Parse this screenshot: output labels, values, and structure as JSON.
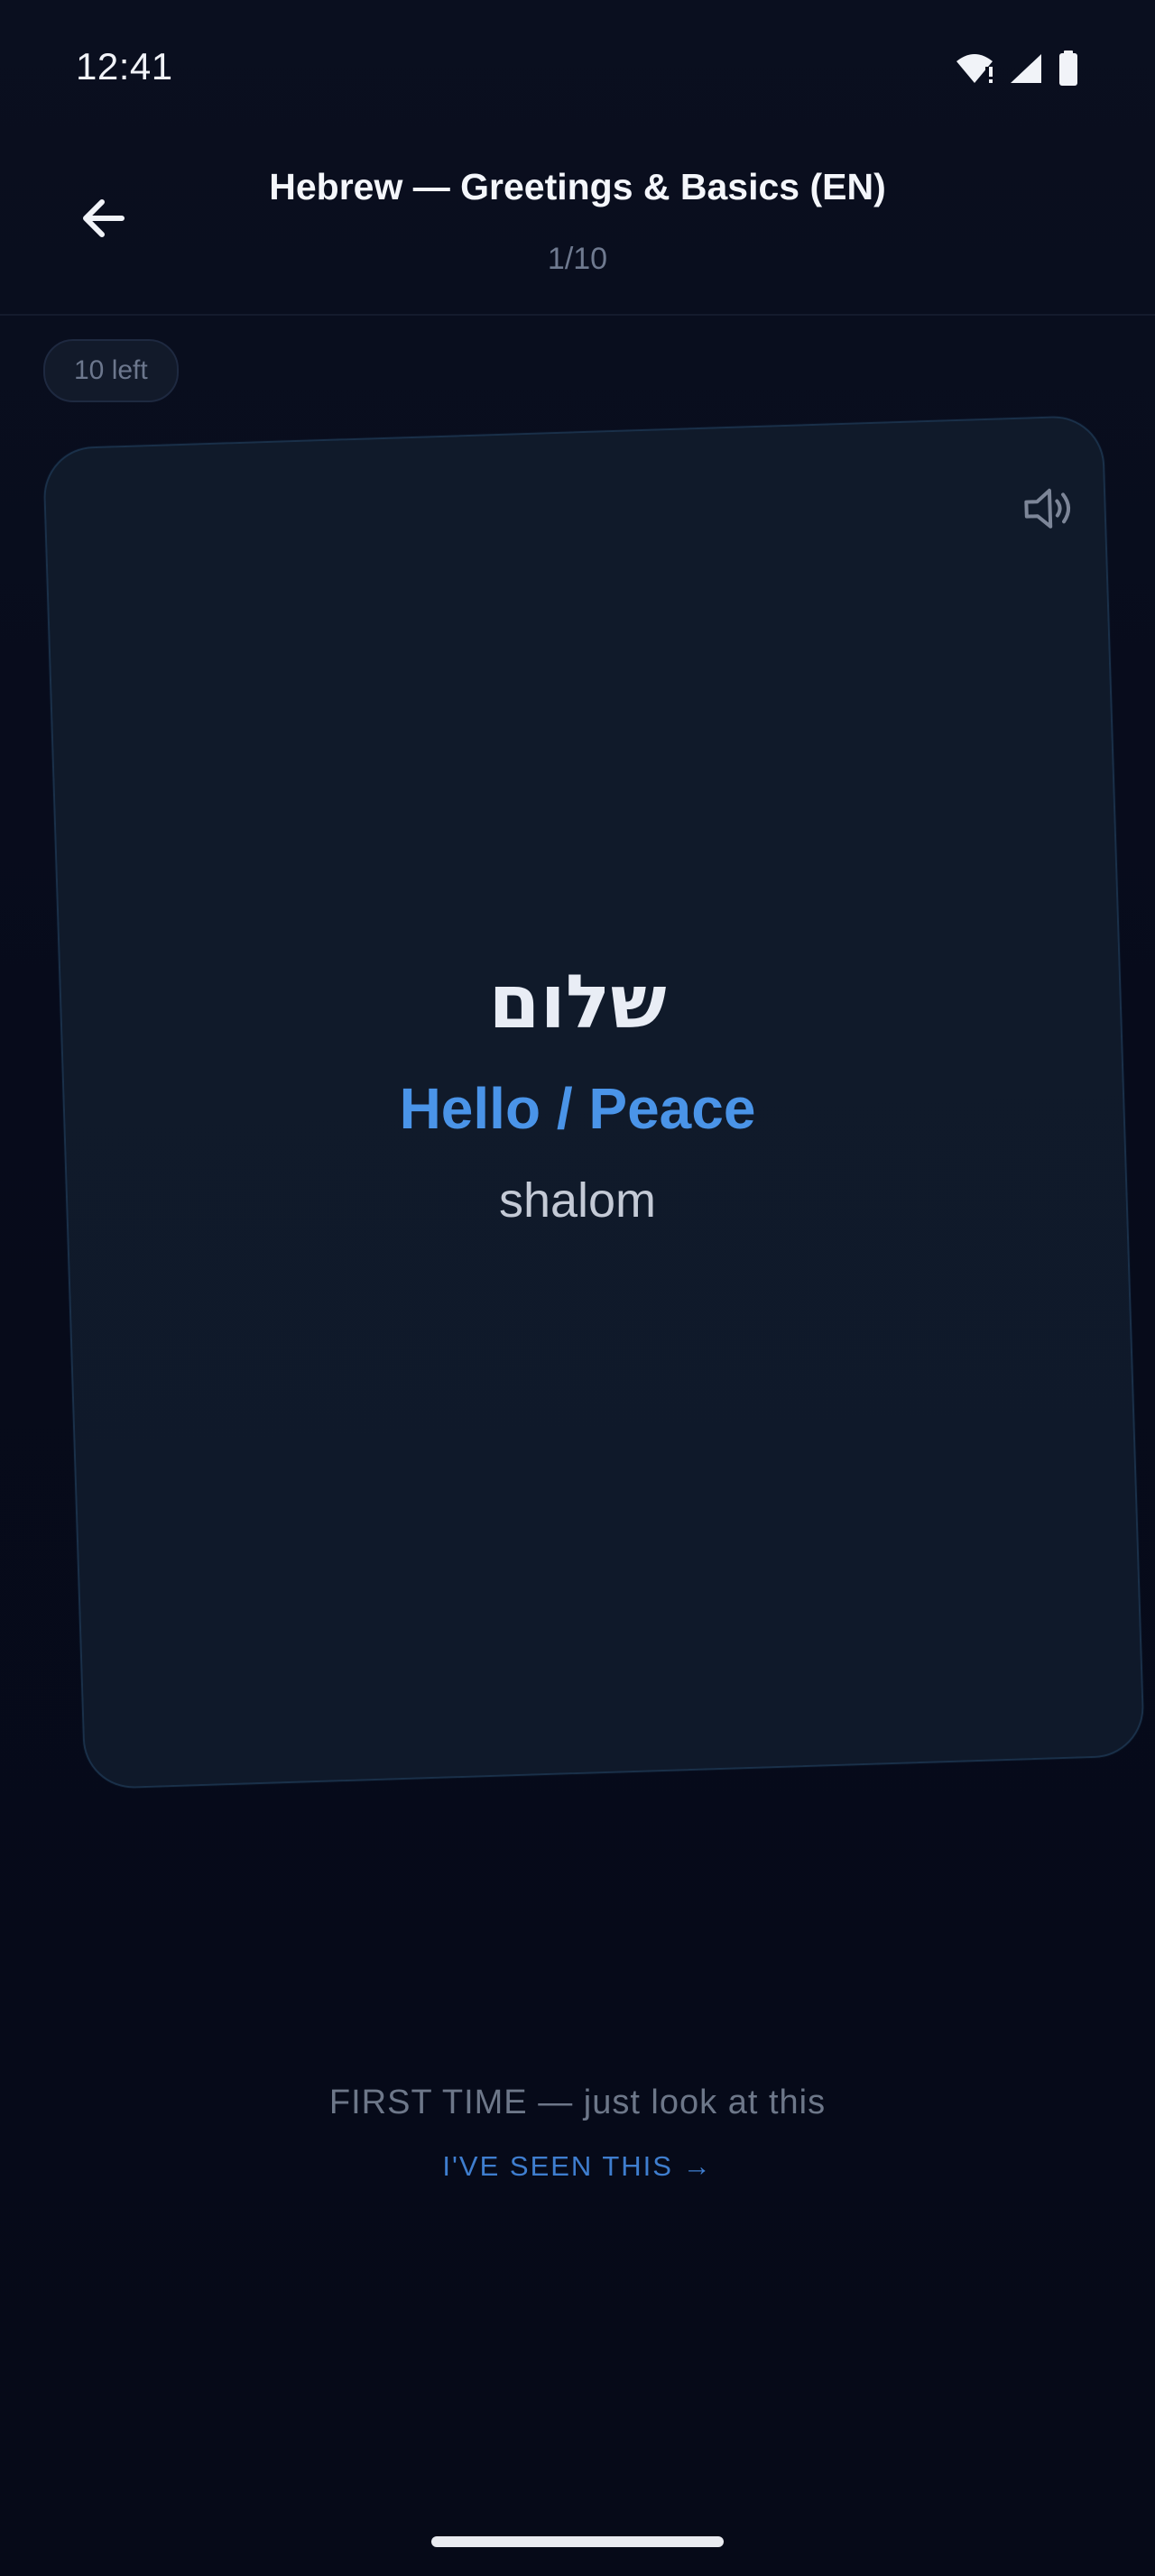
{
  "status_bar": {
    "time": "12:41",
    "icons": [
      "wifi-alert-icon",
      "cellular-signal-icon",
      "battery-icon"
    ]
  },
  "header": {
    "title": "Hebrew — Greetings & Basics (EN)",
    "progress": "1/10",
    "back_icon": "arrow-left-icon"
  },
  "remaining": {
    "label": "10 left"
  },
  "card": {
    "word": "שלום",
    "translation": "Hello / Peace",
    "transliteration": "shalom",
    "audio_icon": "speaker-icon"
  },
  "footer": {
    "hint": "FIRST TIME — just look at this",
    "action_label": "I'VE SEEN THIS →"
  },
  "colors": {
    "background": "#070b1a",
    "card": "#101a2a",
    "card_border": "#1a3049",
    "accent": "#4a94e8",
    "muted": "#6d7789"
  }
}
